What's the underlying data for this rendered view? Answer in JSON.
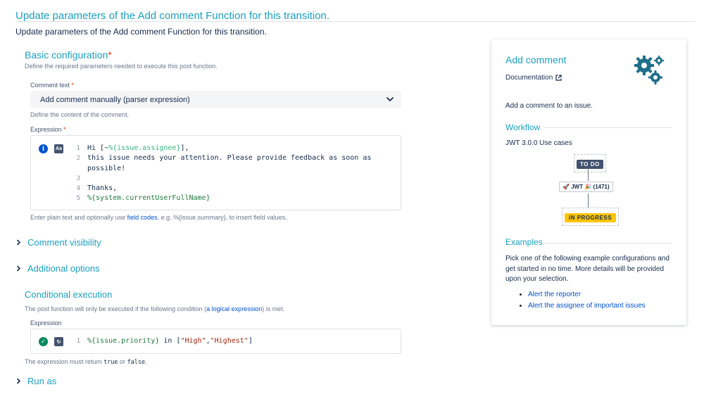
{
  "header": {
    "title": "Update parameters of the Add comment Function for this transition.",
    "description": "Update parameters of the Add comment Function for this transition."
  },
  "basic_config": {
    "title": "Basic configuration",
    "required_mark": "*",
    "hint": "Define the required parameters needed to execute this post function.",
    "comment_text_label": "Comment text",
    "comment_text_value": "Add comment manually (parser expression)",
    "comment_text_hint": "Define the content of the comment.",
    "expression_label": "Expression",
    "expression_lines": [
      {
        "n": "1",
        "pre": "Hi [~",
        "var": "%{issue.assignee}",
        "post": "],"
      },
      {
        "n": "2",
        "pre": "this issue needs your attention. Please provide feedback as soon as",
        "var": "",
        "post": ""
      },
      {
        "n": "",
        "pre": "possible!",
        "var": "",
        "post": ""
      },
      {
        "n": "3",
        "pre": "",
        "var": "",
        "post": ""
      },
      {
        "n": "4",
        "pre": "Thanks,",
        "var": "",
        "post": ""
      },
      {
        "n": "5",
        "pre": "",
        "var": "%{system.currentUserFullName}",
        "post": ""
      }
    ],
    "expression_hint_pre": "Enter plain text and optionally use ",
    "expression_hint_link": "field codes",
    "expression_hint_post": ", e.g. %{issue.summary}, to insert field values."
  },
  "collapsibles": {
    "comment_visibility": "Comment visibility",
    "additional_options": "Additional options",
    "run_as": "Run as"
  },
  "conditional": {
    "title": "Conditional execution",
    "hint_pre": "The post function will only be executed if the following condition (",
    "hint_link": "a logical expression",
    "hint_post": ") is met.",
    "expression_label": "Expression",
    "line_number": "1",
    "code_var": "%{issue.priority}",
    "code_in": " in [",
    "code_str1": "\"High\"",
    "code_comma": ",",
    "code_str2": "\"Highest\"",
    "code_close": "]",
    "result_hint_pre": "The expression must return ",
    "result_true": "true",
    "result_or": " or ",
    "result_false": "false",
    "result_end": "."
  },
  "panel": {
    "title": "Add comment",
    "doc_link": "Documentation",
    "description": "Add a comment to an issue.",
    "workflow_title": "Workflow",
    "workflow_caption": "JWT 3.0.0 Use cases",
    "status_from": "TO DO",
    "transition": "JWT",
    "transition_id": "(1471)",
    "status_to": "IN PROGRESS",
    "examples_title": "Examples",
    "examples_text": "Pick one of the following example configurations and get started in no time. More details will be provided upon your selection.",
    "examples": [
      "Alert the reporter",
      "Alert the assignee of important issues"
    ]
  },
  "colors": {
    "accent": "#1ba0c0",
    "link": "#0052cc",
    "todo": "#42526e",
    "in_progress": "#ffc400",
    "valid": "#00875a",
    "info": "#0052cc"
  },
  "icons": [
    "info-icon",
    "text-format-icon",
    "check-circle-icon",
    "parser-icon",
    "chevron-down-icon",
    "chevron-right-icon",
    "external-link-icon",
    "gears-icon",
    "rocket-icon",
    "party-icon"
  ]
}
